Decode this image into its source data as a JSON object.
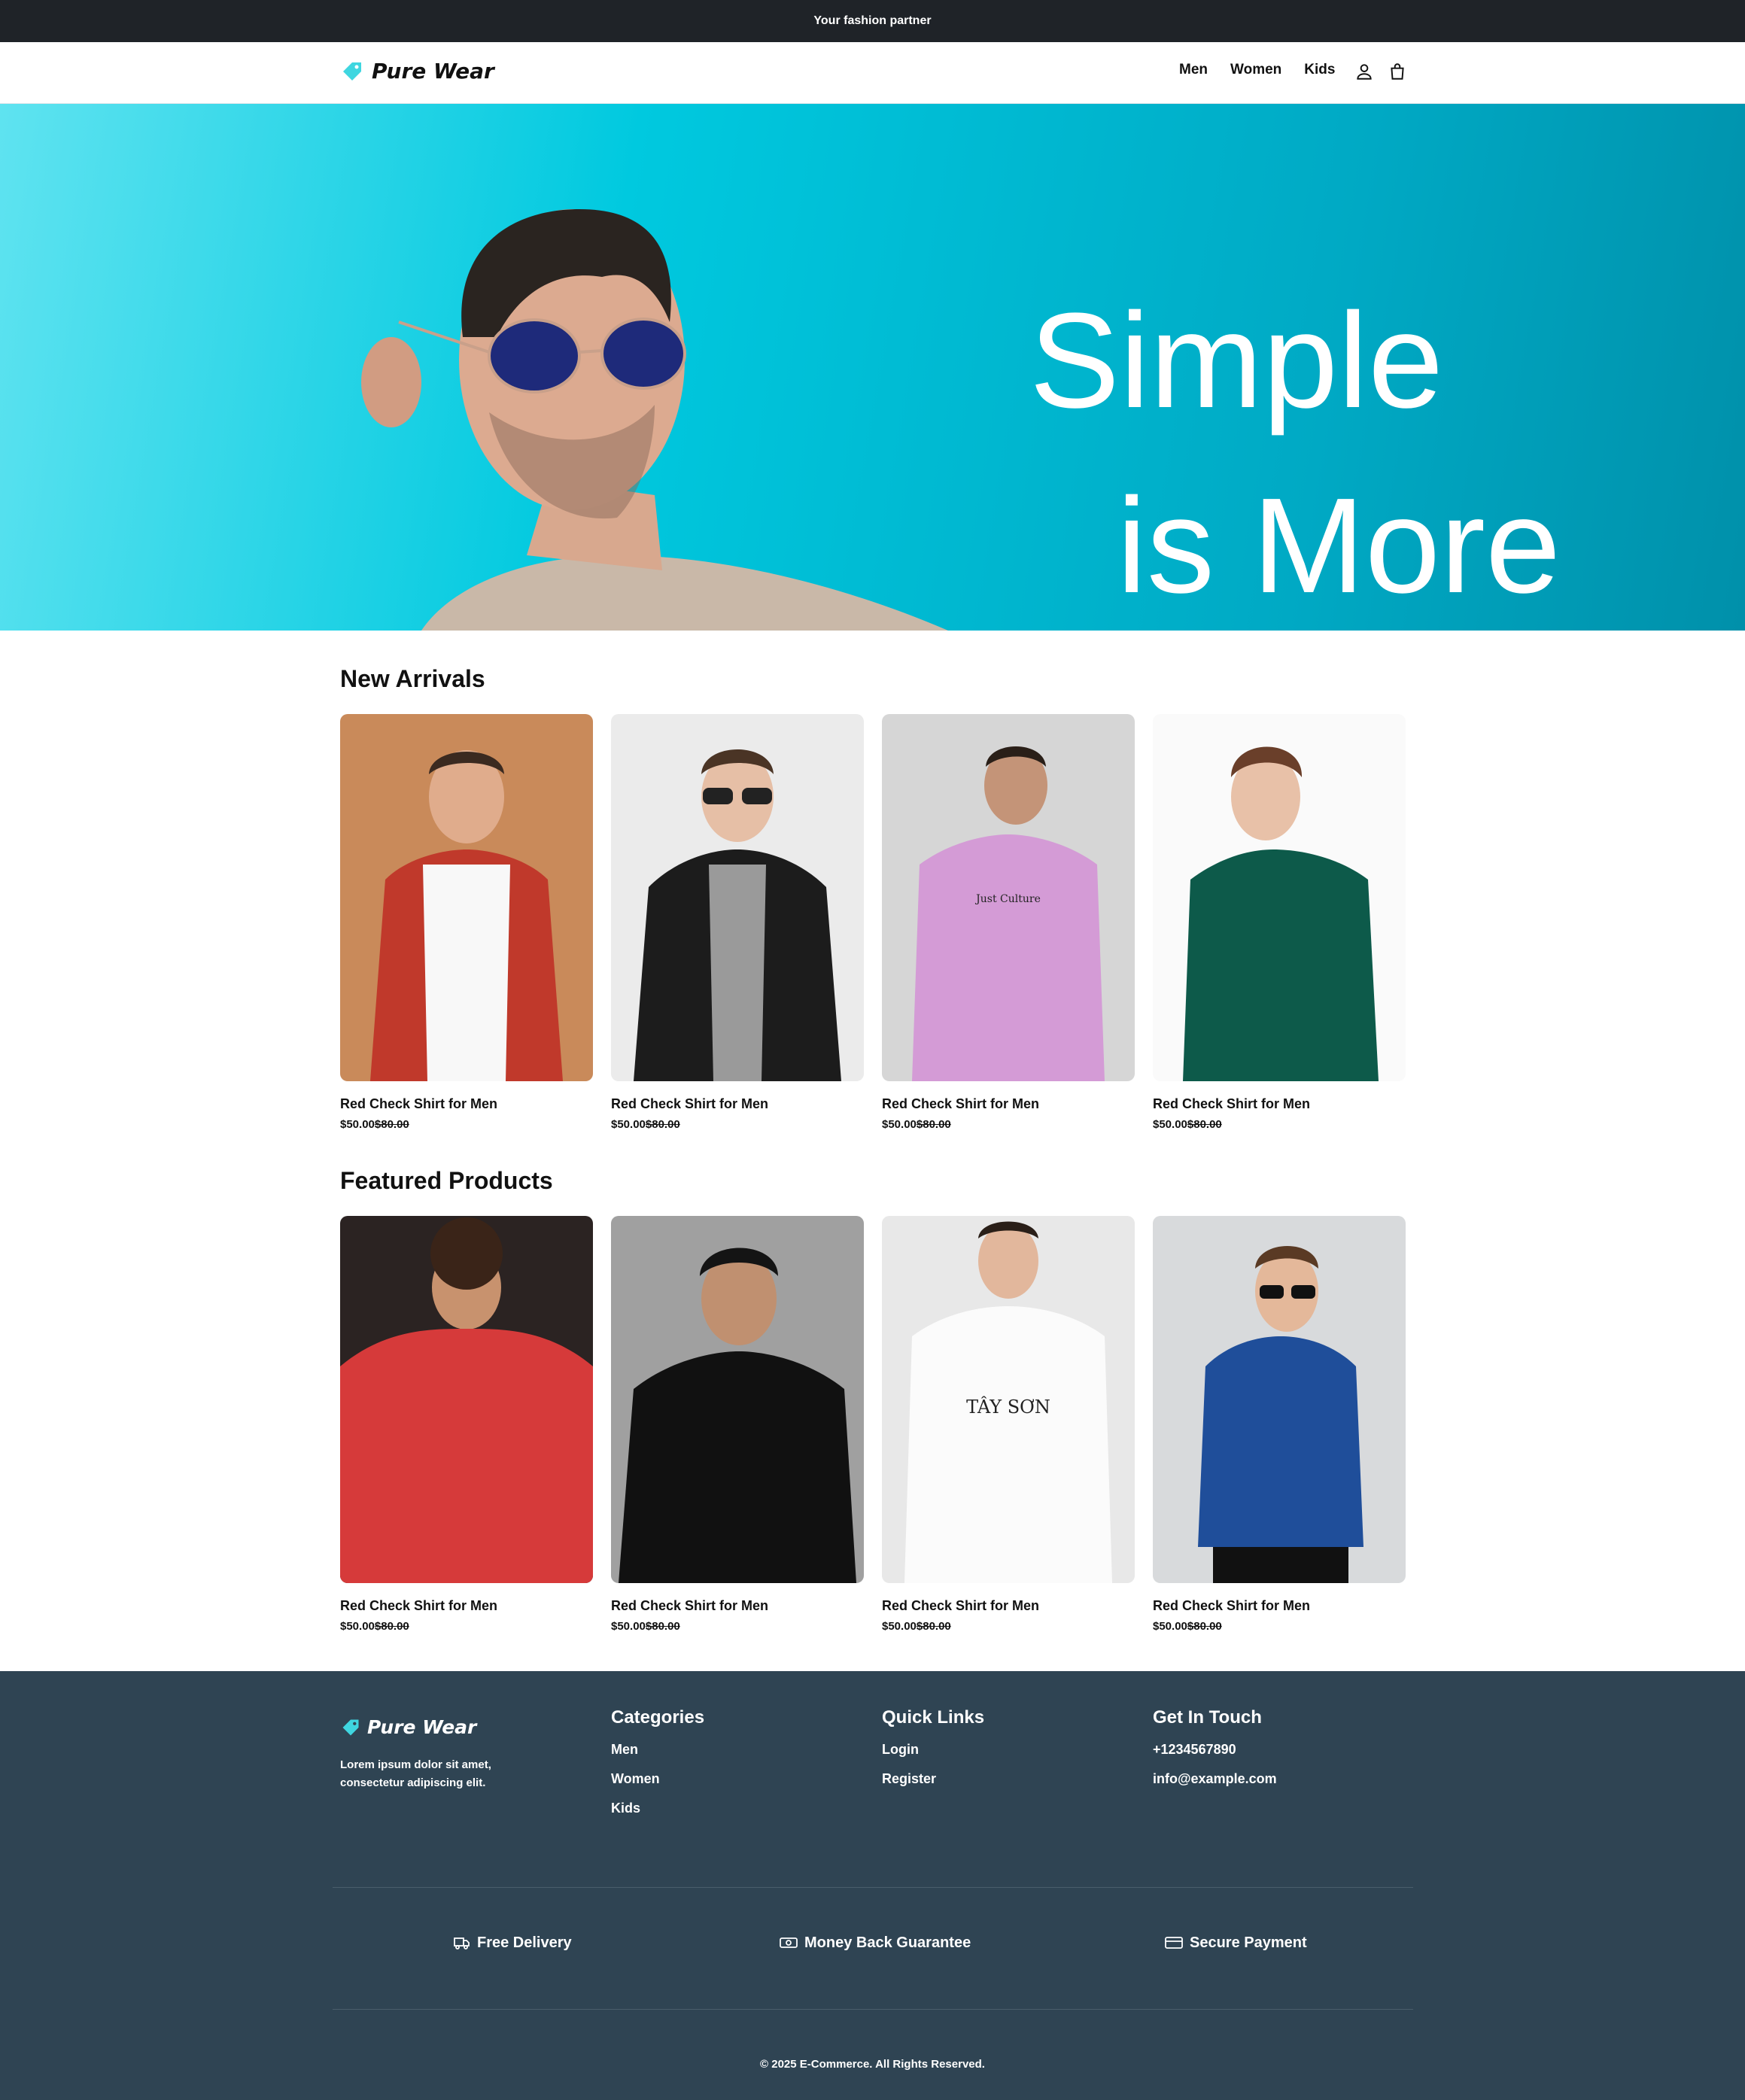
{
  "topbar": {
    "text": "Your fashion partner"
  },
  "brand": {
    "name": "Pure Wear",
    "accent": "#3fd6e0"
  },
  "nav": {
    "items": [
      "Men",
      "Women",
      "Kids"
    ]
  },
  "hero": {
    "line1": "Simple",
    "line2": "is More"
  },
  "new_arrivals": {
    "title": "New Arrivals",
    "products": [
      {
        "name": "Red Check Shirt for Men",
        "price": "$50.00",
        "old_price": "$80.00"
      },
      {
        "name": "Red Check Shirt for Men",
        "price": "$50.00",
        "old_price": "$80.00"
      },
      {
        "name": "Red Check Shirt for Men",
        "price": "$50.00",
        "old_price": "$80.00"
      },
      {
        "name": "Red Check Shirt for Men",
        "price": "$50.00",
        "old_price": "$80.00"
      }
    ]
  },
  "featured": {
    "title": "Featured Products",
    "products": [
      {
        "name": "Red Check Shirt for Men",
        "price": "$50.00",
        "old_price": "$80.00"
      },
      {
        "name": "Red Check Shirt for Men",
        "price": "$50.00",
        "old_price": "$80.00"
      },
      {
        "name": "Red Check Shirt for Men",
        "price": "$50.00",
        "old_price": "$80.00"
      },
      {
        "name": "Red Check Shirt for Men",
        "price": "$50.00",
        "old_price": "$80.00"
      }
    ]
  },
  "footer": {
    "brand": "Pure Wear",
    "description": "Lorem ipsum dolor sit amet, consectetur adipiscing elit.",
    "categories": {
      "title": "Categories",
      "items": [
        "Men",
        "Women",
        "Kids"
      ]
    },
    "quick_links": {
      "title": "Quick Links",
      "items": [
        "Login",
        "Register"
      ]
    },
    "contact": {
      "title": "Get In Touch",
      "phone": "+1234567890",
      "email": "info@example.com"
    },
    "features": [
      "Free Delivery",
      "Money Back Guarantee",
      "Secure Payment"
    ],
    "copyright": "© 2025 E-Commerce. All Rights Reserved."
  }
}
